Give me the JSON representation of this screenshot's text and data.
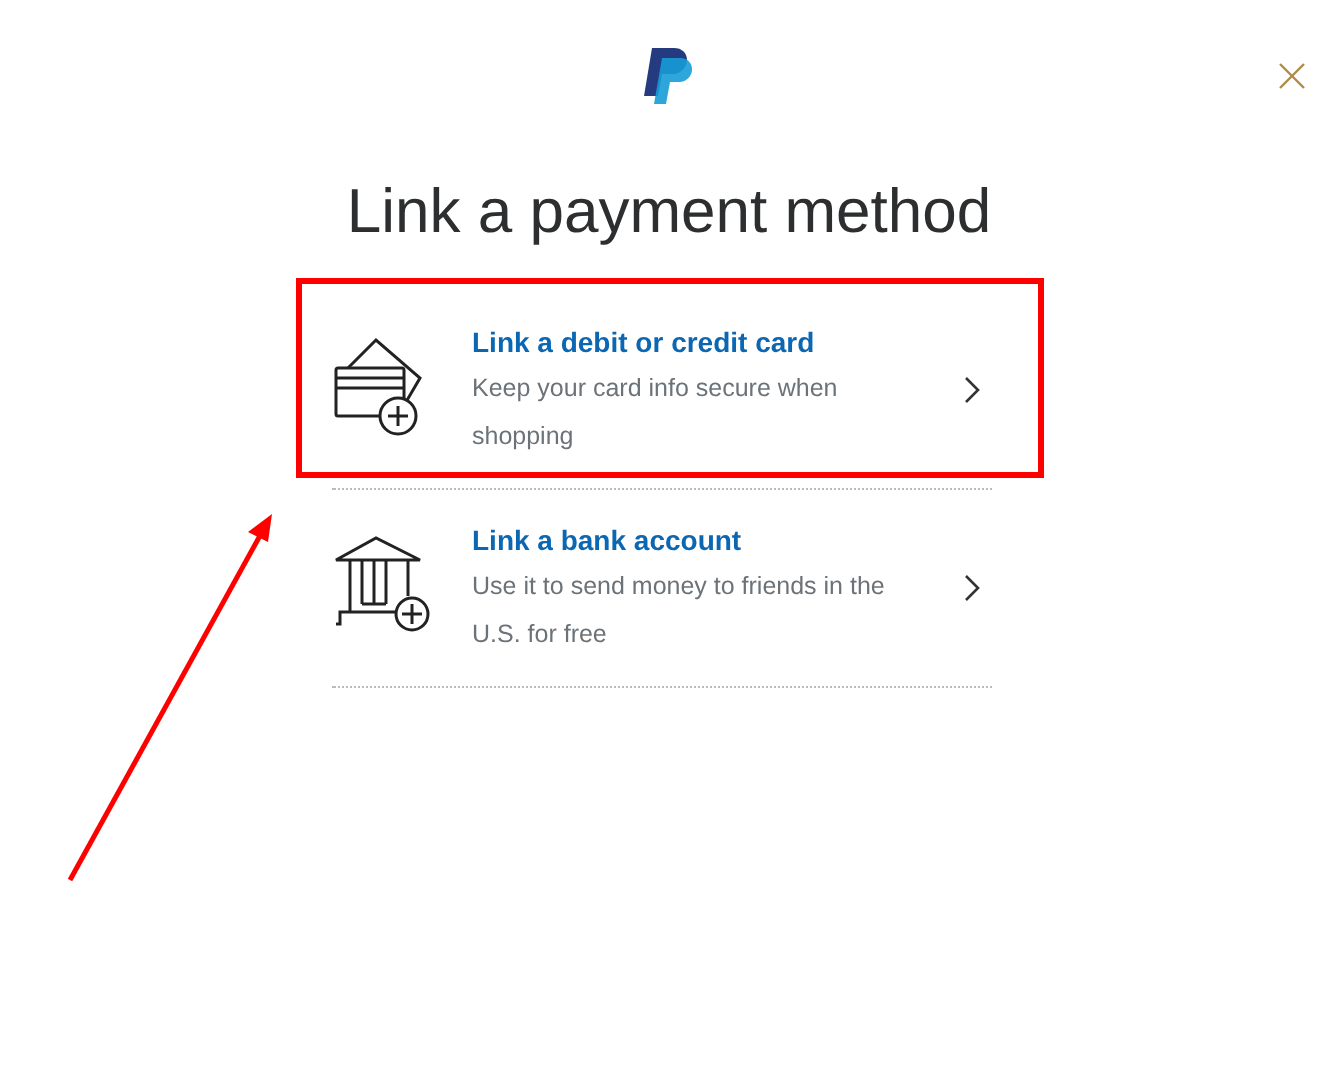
{
  "title": "Link a payment method",
  "options": [
    {
      "kind": "card",
      "title": "Link a debit or credit card",
      "description": "Keep your card info secure when shopping",
      "highlighted": true
    },
    {
      "kind": "bank",
      "title": "Link a bank account",
      "description": "Use it to send money to friends in the U.S. for free",
      "highlighted": false
    }
  ],
  "annotation_arrow": true
}
